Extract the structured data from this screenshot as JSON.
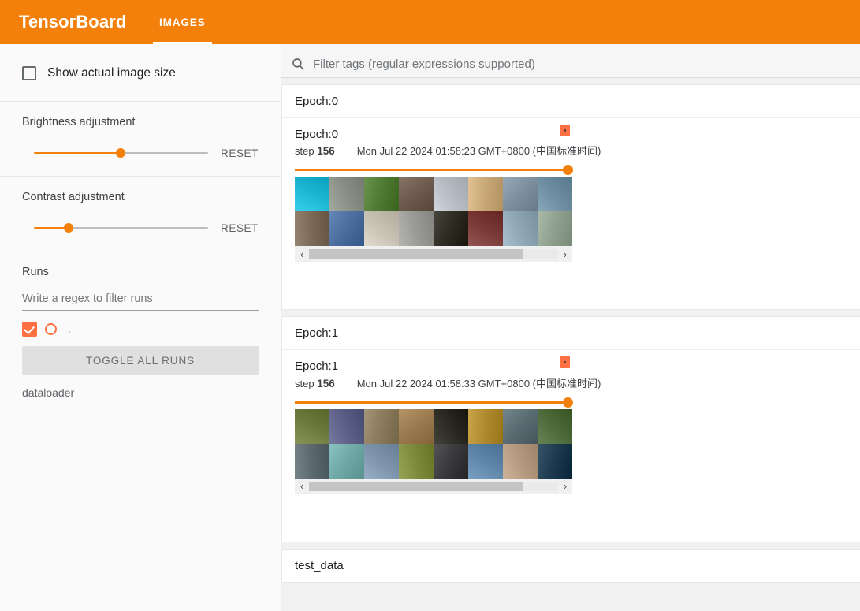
{
  "header": {
    "brand": "TensorBoard",
    "tabs": [
      {
        "label": "IMAGES",
        "active": true
      }
    ]
  },
  "sidebar": {
    "show_actual_size": {
      "label": "Show actual image size",
      "checked": false,
      "icon": "checkbox-unchecked-icon"
    },
    "brightness": {
      "title": "Brightness adjustment",
      "reset_label": "RESET",
      "value_percent": 50
    },
    "contrast": {
      "title": "Contrast adjustment",
      "reset_label": "RESET",
      "value_percent": 20
    },
    "runs": {
      "title": "Runs",
      "filter_placeholder": "Write a regex to filter runs",
      "filter_value": "",
      "run_items": [
        {
          "name": ".",
          "checked": true,
          "color": "#ff7043"
        }
      ],
      "toggle_all_label": "TOGGLE ALL RUNS",
      "footer_label": "dataloader"
    }
  },
  "search": {
    "placeholder": "Filter tags (regular expressions supported)",
    "value": "",
    "icon": "search-icon"
  },
  "main": {
    "sections": [
      {
        "header": "Epoch:0",
        "card": {
          "title": "Epoch:0",
          "step_label": "step",
          "step_value": "156",
          "timestamp": "Mon Jul 22 2024 01:58:23 GMT+0800 (中国标准时间)",
          "pin_icon": "pin-icon",
          "slider_percent": 100,
          "prev_icon": "chevron-left-icon",
          "next_icon": "chevron-right-icon",
          "thumbnails": [
            "#1fb6d4",
            "#8a8f86",
            "#4f7a34",
            "#6d5b4f",
            "#b6bcc3",
            "#c9a878",
            "#7e8f9e",
            "#6c8ea0",
            "#7b6a58",
            "#4a6d9e",
            "#c8c2b4",
            "#9a9a96",
            "#2d2b22",
            "#7a3a38",
            "#8fa6b4",
            "#90a08e"
          ]
        }
      },
      {
        "header": "Epoch:1",
        "card": {
          "title": "Epoch:1",
          "step_label": "step",
          "step_value": "156",
          "timestamp": "Mon Jul 22 2024 01:58:33 GMT+0800 (中国标准时间)",
          "pin_icon": "pin-icon",
          "slider_percent": 100,
          "prev_icon": "chevron-left-icon",
          "next_icon": "chevron-right-icon",
          "thumbnails": [
            "#6e7a3e",
            "#5b5f86",
            "#8a7b5c",
            "#9a7a4e",
            "#2a2a22",
            "#b08a2e",
            "#5a6b72",
            "#4d6a3a",
            "#5c6a70",
            "#6fa8a6",
            "#7e94ac",
            "#7d8a3c",
            "#3a3a3c",
            "#5f85a8",
            "#b49a7e",
            "#1d3a4e"
          ]
        }
      },
      {
        "header": "test_data",
        "card": null
      }
    ]
  }
}
